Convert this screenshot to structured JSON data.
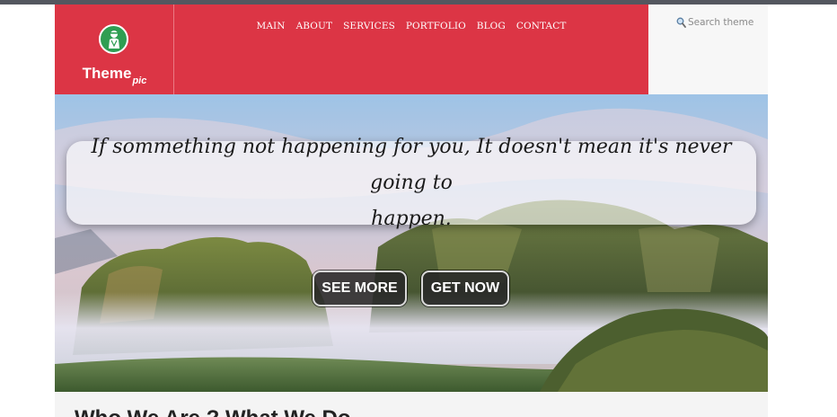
{
  "brand": {
    "name": "Theme",
    "suffix": "pic"
  },
  "nav": {
    "items": [
      "MAIN",
      "ABOUT",
      "SERVICES",
      "PORTFOLIO",
      "BLOG",
      "CONTACT"
    ]
  },
  "search": {
    "placeholder": "Search theme"
  },
  "hero": {
    "quote_line1": "If sommething not happening for you, It doesn't mean it's never going to",
    "quote_line2": "happen.",
    "see_more_label": "SEE MORE",
    "get_now_label": "GET NOW"
  },
  "section": {
    "title": "Who We Are ? What We Do"
  },
  "colors": {
    "accent": "#dc3545",
    "topbar": "#54575f",
    "button": "#2b2b2b"
  }
}
